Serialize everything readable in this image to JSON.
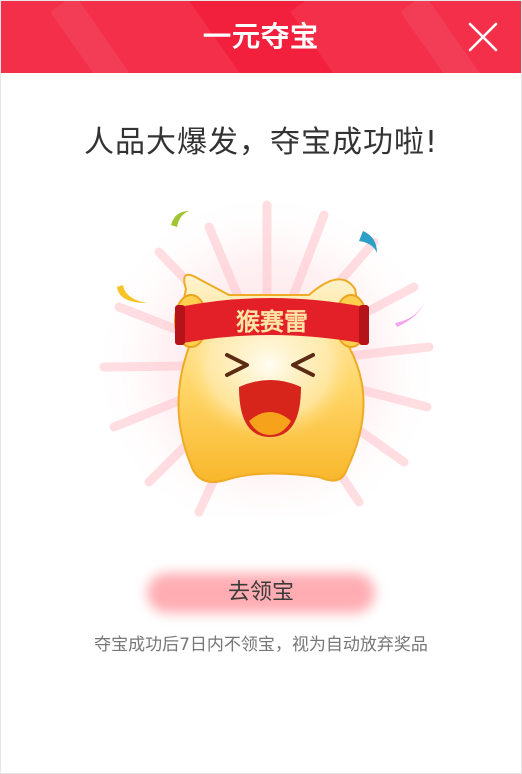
{
  "header": {
    "title": "一元夺宝",
    "close_icon": "close-icon",
    "background_color": "#f3203d"
  },
  "main": {
    "headline": "人品大爆发，夺宝成功啦!",
    "mascot": {
      "banner_text": "猴赛雷",
      "icon": "cheering-mascot-illustration"
    },
    "claim_button_label": "去领宝",
    "notice": "夺宝成功后7日内不领宝，视为自动放弃奖品"
  }
}
